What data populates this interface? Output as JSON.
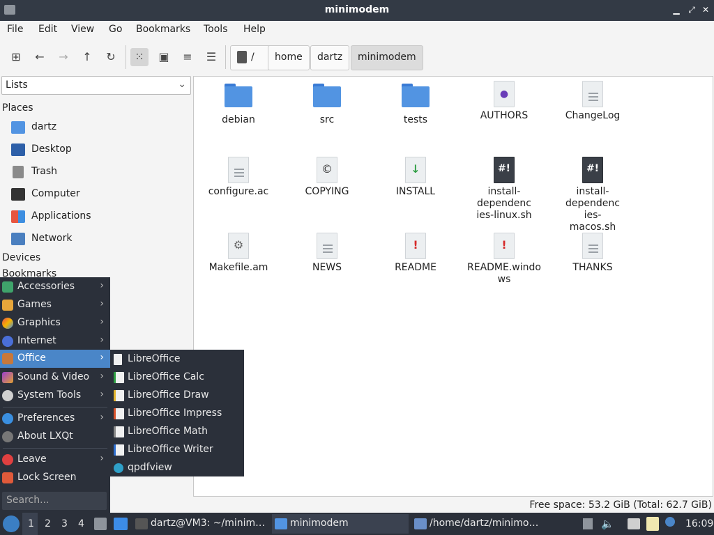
{
  "window": {
    "title": "minimodem"
  },
  "menubar": [
    "File",
    "Edit",
    "View",
    "Go",
    "Bookmarks",
    "Tools",
    "Help"
  ],
  "breadcrumb": {
    "root": "/",
    "parts": [
      "home",
      "dartz",
      "minimodem"
    ]
  },
  "sidebar": {
    "select_value": "Lists",
    "places_title": "Places",
    "places": [
      "dartz",
      "Desktop",
      "Trash",
      "Computer",
      "Applications",
      "Network"
    ],
    "devices_title": "Devices",
    "bookmarks_title": "Bookmarks"
  },
  "files": [
    {
      "name": "debian",
      "kind": "folder"
    },
    {
      "name": "src",
      "kind": "folder"
    },
    {
      "name": "tests",
      "kind": "folder"
    },
    {
      "name": "AUTHORS",
      "kind": "authors"
    },
    {
      "name": "ChangeLog",
      "kind": "text"
    },
    {
      "name": "configure.ac",
      "kind": "text"
    },
    {
      "name": "COPYING",
      "kind": "copying"
    },
    {
      "name": "INSTALL",
      "kind": "install"
    },
    {
      "name": "install-dependencies-linux.sh",
      "kind": "script"
    },
    {
      "name": "install-dependencies-macos.sh",
      "kind": "script"
    },
    {
      "name": "Makefile.am",
      "kind": "make"
    },
    {
      "name": "NEWS",
      "kind": "text"
    },
    {
      "name": "README",
      "kind": "readme"
    },
    {
      "name": "README.windows",
      "kind": "readme"
    },
    {
      "name": "THANKS",
      "kind": "text"
    }
  ],
  "status": {
    "free_space": "Free space: 53.2 GiB (Total: 62.7 GiB)"
  },
  "app_menu": {
    "items": [
      "Accessories",
      "Games",
      "Graphics",
      "Internet",
      "Office",
      "Sound & Video",
      "System Tools"
    ],
    "items2": [
      "Preferences",
      "About LXQt"
    ],
    "items3": [
      "Leave",
      "Lock Screen"
    ],
    "search_placeholder": "Search..."
  },
  "office_submenu": [
    "LibreOffice",
    "LibreOffice Calc",
    "LibreOffice Draw",
    "LibreOffice Impress",
    "LibreOffice Math",
    "LibreOffice Writer",
    "qpdfview"
  ],
  "taskbar": {
    "desktops": [
      "1",
      "2",
      "3",
      "4"
    ],
    "tasks": [
      "dartz@VM3: ~/minim…",
      "minimodem",
      "/home/dartz/minimo…"
    ],
    "clock": "16:09"
  },
  "colors": {
    "accent": "#4a86c8",
    "panel": "#2b303a",
    "folder": "#5294e2"
  }
}
